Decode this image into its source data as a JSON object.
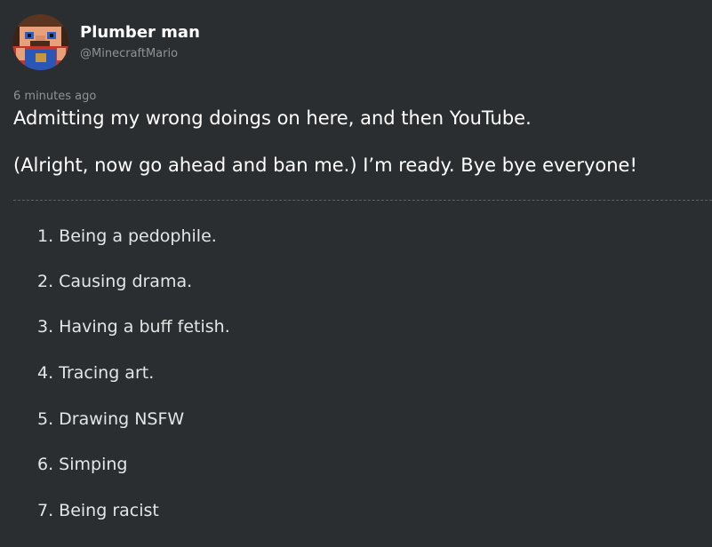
{
  "author": {
    "display_name": "Plumber man",
    "handle": "@MinecraftMario"
  },
  "post": {
    "timestamp": "6 minutes ago",
    "lines": [
      "Admitting my wrong doings on here, and then YouTube.",
      "(Alright, now go ahead and ban me.) I’m ready. Bye bye everyone!"
    ],
    "list": [
      "1. Being a pedophile.",
      "2. Causing drama.",
      "3. Having a buff fetish.",
      "4. Tracing art.",
      "5. Drawing NSFW",
      "6. Simping",
      "7. Being racist"
    ]
  },
  "colors": {
    "background": "#2b2e30",
    "text": "#ffffff",
    "muted": "#8d9396",
    "divider": "#5c6164"
  },
  "icons": {
    "avatar": "pixel-mario-avatar"
  }
}
